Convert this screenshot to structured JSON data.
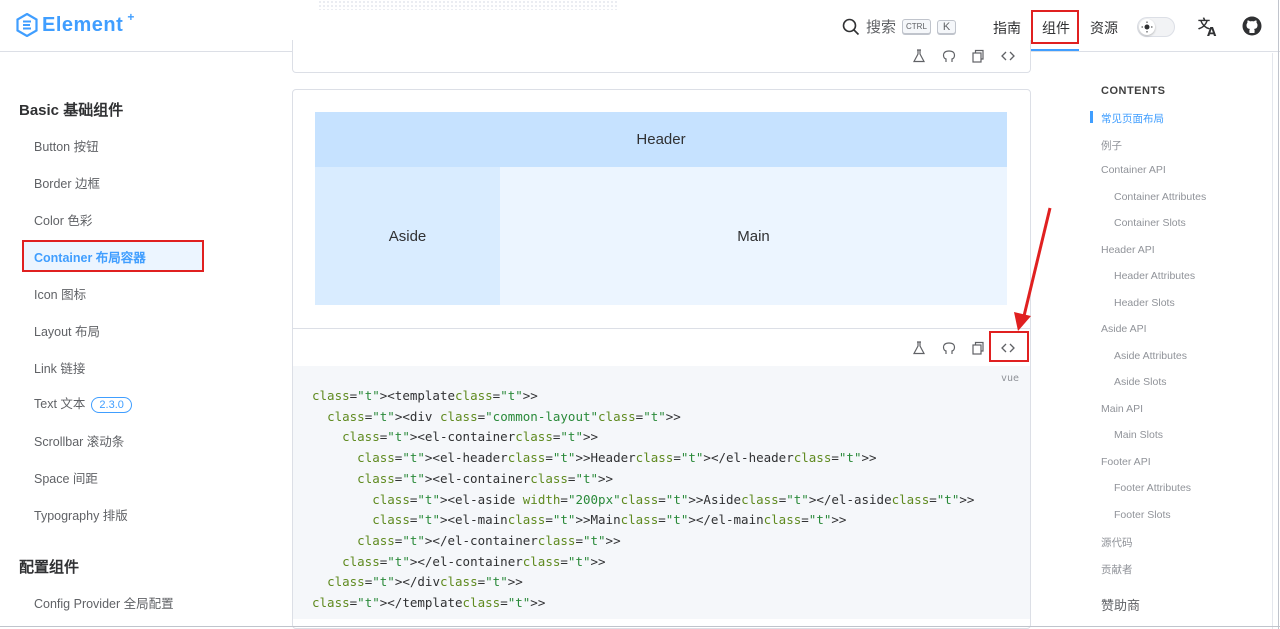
{
  "brand": {
    "name": "Element",
    "plus": "+"
  },
  "header": {
    "search_label": "搜索",
    "search_kbd_ctrl": "CTRL",
    "search_kbd_k": "K",
    "nav": [
      "指南",
      "组件",
      "资源"
    ],
    "active_nav": "组件"
  },
  "sidebar": {
    "groups": [
      {
        "title": "Basic 基础组件",
        "items": [
          {
            "label": "Button 按钮"
          },
          {
            "label": "Border 边框"
          },
          {
            "label": "Color 色彩"
          },
          {
            "label": "Container 布局容器",
            "active": true
          },
          {
            "label": "Icon 图标"
          },
          {
            "label": "Layout 布局"
          },
          {
            "label": "Link 链接"
          },
          {
            "label": "Text 文本",
            "badge": "2.3.0"
          },
          {
            "label": "Scrollbar 滚动条"
          },
          {
            "label": "Space 间距"
          },
          {
            "label": "Typography 排版"
          }
        ]
      },
      {
        "title": "配置组件",
        "items": [
          {
            "label": "Config Provider 全局配置"
          }
        ]
      }
    ]
  },
  "demo": {
    "header_label": "Header",
    "aside_label": "Aside",
    "main_label": "Main",
    "code_lang": "vue",
    "code_lines": [
      "<template>",
      "  <div class=\"common-layout\">",
      "    <el-container>",
      "      <el-header>Header</el-header>",
      "      <el-container>",
      "        <el-aside width=\"200px\">Aside</el-aside>",
      "        <el-main>Main</el-main>",
      "      </el-container>",
      "    </el-container>",
      "  </div>",
      "</template>"
    ]
  },
  "toc": {
    "title": "CONTENTS",
    "items": [
      {
        "label": "常见页面布局",
        "level": 1,
        "active": true
      },
      {
        "label": "例子",
        "level": 1
      },
      {
        "label": "Container API",
        "level": 1
      },
      {
        "label": "Container Attributes",
        "level": 2
      },
      {
        "label": "Container Slots",
        "level": 2
      },
      {
        "label": "Header API",
        "level": 1
      },
      {
        "label": "Header Attributes",
        "level": 2
      },
      {
        "label": "Header Slots",
        "level": 2
      },
      {
        "label": "Aside API",
        "level": 1
      },
      {
        "label": "Aside Attributes",
        "level": 2
      },
      {
        "label": "Aside Slots",
        "level": 2
      },
      {
        "label": "Main API",
        "level": 1
      },
      {
        "label": "Main Slots",
        "level": 2
      },
      {
        "label": "Footer API",
        "level": 1
      },
      {
        "label": "Footer Attributes",
        "level": 2
      },
      {
        "label": "Footer Slots",
        "level": 2
      },
      {
        "label": "源代码",
        "level": 1
      },
      {
        "label": "贡献者",
        "level": 1
      }
    ],
    "sponsors": "赞助商"
  },
  "colors": {
    "accent": "#409eff",
    "highlight_box": "#e02020",
    "header_bg": "#c6e2ff",
    "aside_bg": "#d9ecff",
    "main_bg": "#ecf5ff"
  },
  "icons": [
    "search-icon",
    "sun-icon",
    "translate-icon",
    "github-icon",
    "playground-icon",
    "github-edit-icon",
    "copy-icon",
    "code-toggle-icon"
  ]
}
